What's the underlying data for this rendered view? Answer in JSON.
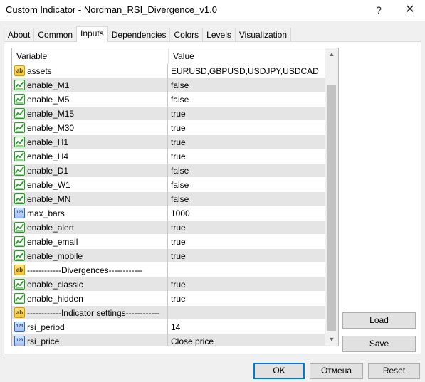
{
  "window": {
    "title": "Custom Indicator - Nordman_RSI_Divergence_v1.0",
    "help_label": "?",
    "close_label": "✕"
  },
  "tabs": [
    {
      "label": "About",
      "active": false
    },
    {
      "label": "Common",
      "active": false
    },
    {
      "label": "Inputs",
      "active": true
    },
    {
      "label": "Dependencies",
      "active": false
    },
    {
      "label": "Colors",
      "active": false
    },
    {
      "label": "Levels",
      "active": false
    },
    {
      "label": "Visualization",
      "active": false
    }
  ],
  "grid": {
    "col_variable": "Variable",
    "col_value": "Value",
    "rows": [
      {
        "icon": "string-icon",
        "name": "assets",
        "value": "EURUSD,GBPUSD,USDJPY,USDCAD"
      },
      {
        "icon": "bool-icon",
        "name": "enable_M1",
        "value": "false"
      },
      {
        "icon": "bool-icon",
        "name": "enable_M5",
        "value": "false"
      },
      {
        "icon": "bool-icon",
        "name": "enable_M15",
        "value": "true"
      },
      {
        "icon": "bool-icon",
        "name": "enable_M30",
        "value": "true"
      },
      {
        "icon": "bool-icon",
        "name": "enable_H1",
        "value": "true"
      },
      {
        "icon": "bool-icon",
        "name": "enable_H4",
        "value": "true"
      },
      {
        "icon": "bool-icon",
        "name": "enable_D1",
        "value": "false"
      },
      {
        "icon": "bool-icon",
        "name": "enable_W1",
        "value": "false"
      },
      {
        "icon": "bool-icon",
        "name": "enable_MN",
        "value": "false"
      },
      {
        "icon": "number-icon",
        "name": "max_bars",
        "value": "1000"
      },
      {
        "icon": "bool-icon",
        "name": "enable_alert",
        "value": "true"
      },
      {
        "icon": "bool-icon",
        "name": "enable_email",
        "value": "true"
      },
      {
        "icon": "bool-icon",
        "name": "enable_mobile",
        "value": "true"
      },
      {
        "icon": "string-icon",
        "name": "------------Divergences------------",
        "value": ""
      },
      {
        "icon": "bool-icon",
        "name": "enable_classic",
        "value": "true"
      },
      {
        "icon": "bool-icon",
        "name": "enable_hidden",
        "value": "true"
      },
      {
        "icon": "string-icon",
        "name": "------------Indicator settings------------",
        "value": ""
      },
      {
        "icon": "number-icon",
        "name": "rsi_period",
        "value": "14"
      },
      {
        "icon": "number-icon",
        "name": "rsi_price",
        "value": "Close price"
      }
    ]
  },
  "icons": {
    "string_glyph": "ab",
    "number_glyph": "123",
    "bool_color": "#2e9a2e"
  },
  "scrollbar": {
    "up": "▲",
    "down": "▼"
  },
  "buttons": {
    "load": "Load",
    "save": "Save",
    "ok": "OK",
    "cancel": "Отмена",
    "reset": "Reset"
  }
}
